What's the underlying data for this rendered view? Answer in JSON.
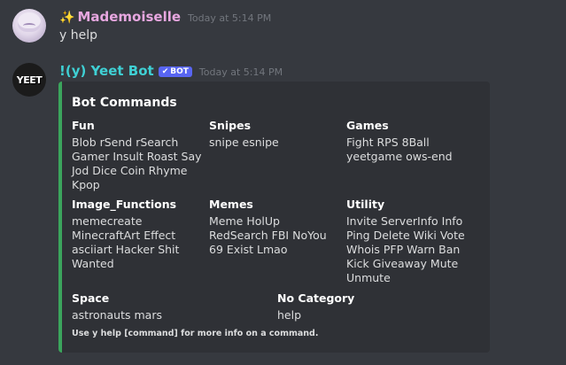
{
  "message_1": {
    "sparkle_icon": "sparkles",
    "username": "Mademoiselle",
    "timestamp": "Today at 5:14 PM",
    "content": "y help"
  },
  "message_2": {
    "avatar_text": "YEET",
    "username": "!(y) Yeet Bot",
    "bot_tag": "BOT",
    "timestamp": "Today at 5:14 PM",
    "embed": {
      "accent_color": "#3ba55c",
      "title": "Bot Commands",
      "fields": {
        "fun": {
          "name": "Fun",
          "lines": [
            "Blob  rSend  rSearch",
            "Gamer  Insult  Roast  Say",
            "Jod  Dice  Coin  Rhyme",
            "Kpop"
          ]
        },
        "snipes": {
          "name": "Snipes",
          "lines": [
            "snipe  esnipe"
          ]
        },
        "games": {
          "name": "Games",
          "lines": [
            "Fight  RPS  8Ball",
            "yeetgame  ows-end"
          ]
        },
        "image_functions": {
          "name": "Image_Functions",
          "lines": [
            "memecreate",
            "MinecraftArt  Effect",
            "asciiart  Hacker  Shit",
            "Wanted"
          ]
        },
        "memes": {
          "name": "Memes",
          "lines": [
            "Meme  HolUp",
            "RedSearch  FBI  NoYou",
            "69  Exist  Lmao"
          ]
        },
        "utility": {
          "name": "Utility",
          "lines": [
            "Invite  ServerInfo  Info",
            "Ping  Delete  Wiki  Vote",
            "Whois  PFP  Warn  Ban",
            "Kick  Giveaway  Mute",
            "Unmute"
          ]
        },
        "space": {
          "name": "Space",
          "lines": [
            "astronauts  mars"
          ]
        },
        "no_category": {
          "name": "No Category",
          "lines": [
            "help"
          ]
        }
      },
      "footer": "Use y help [command] for more info on a command."
    }
  }
}
